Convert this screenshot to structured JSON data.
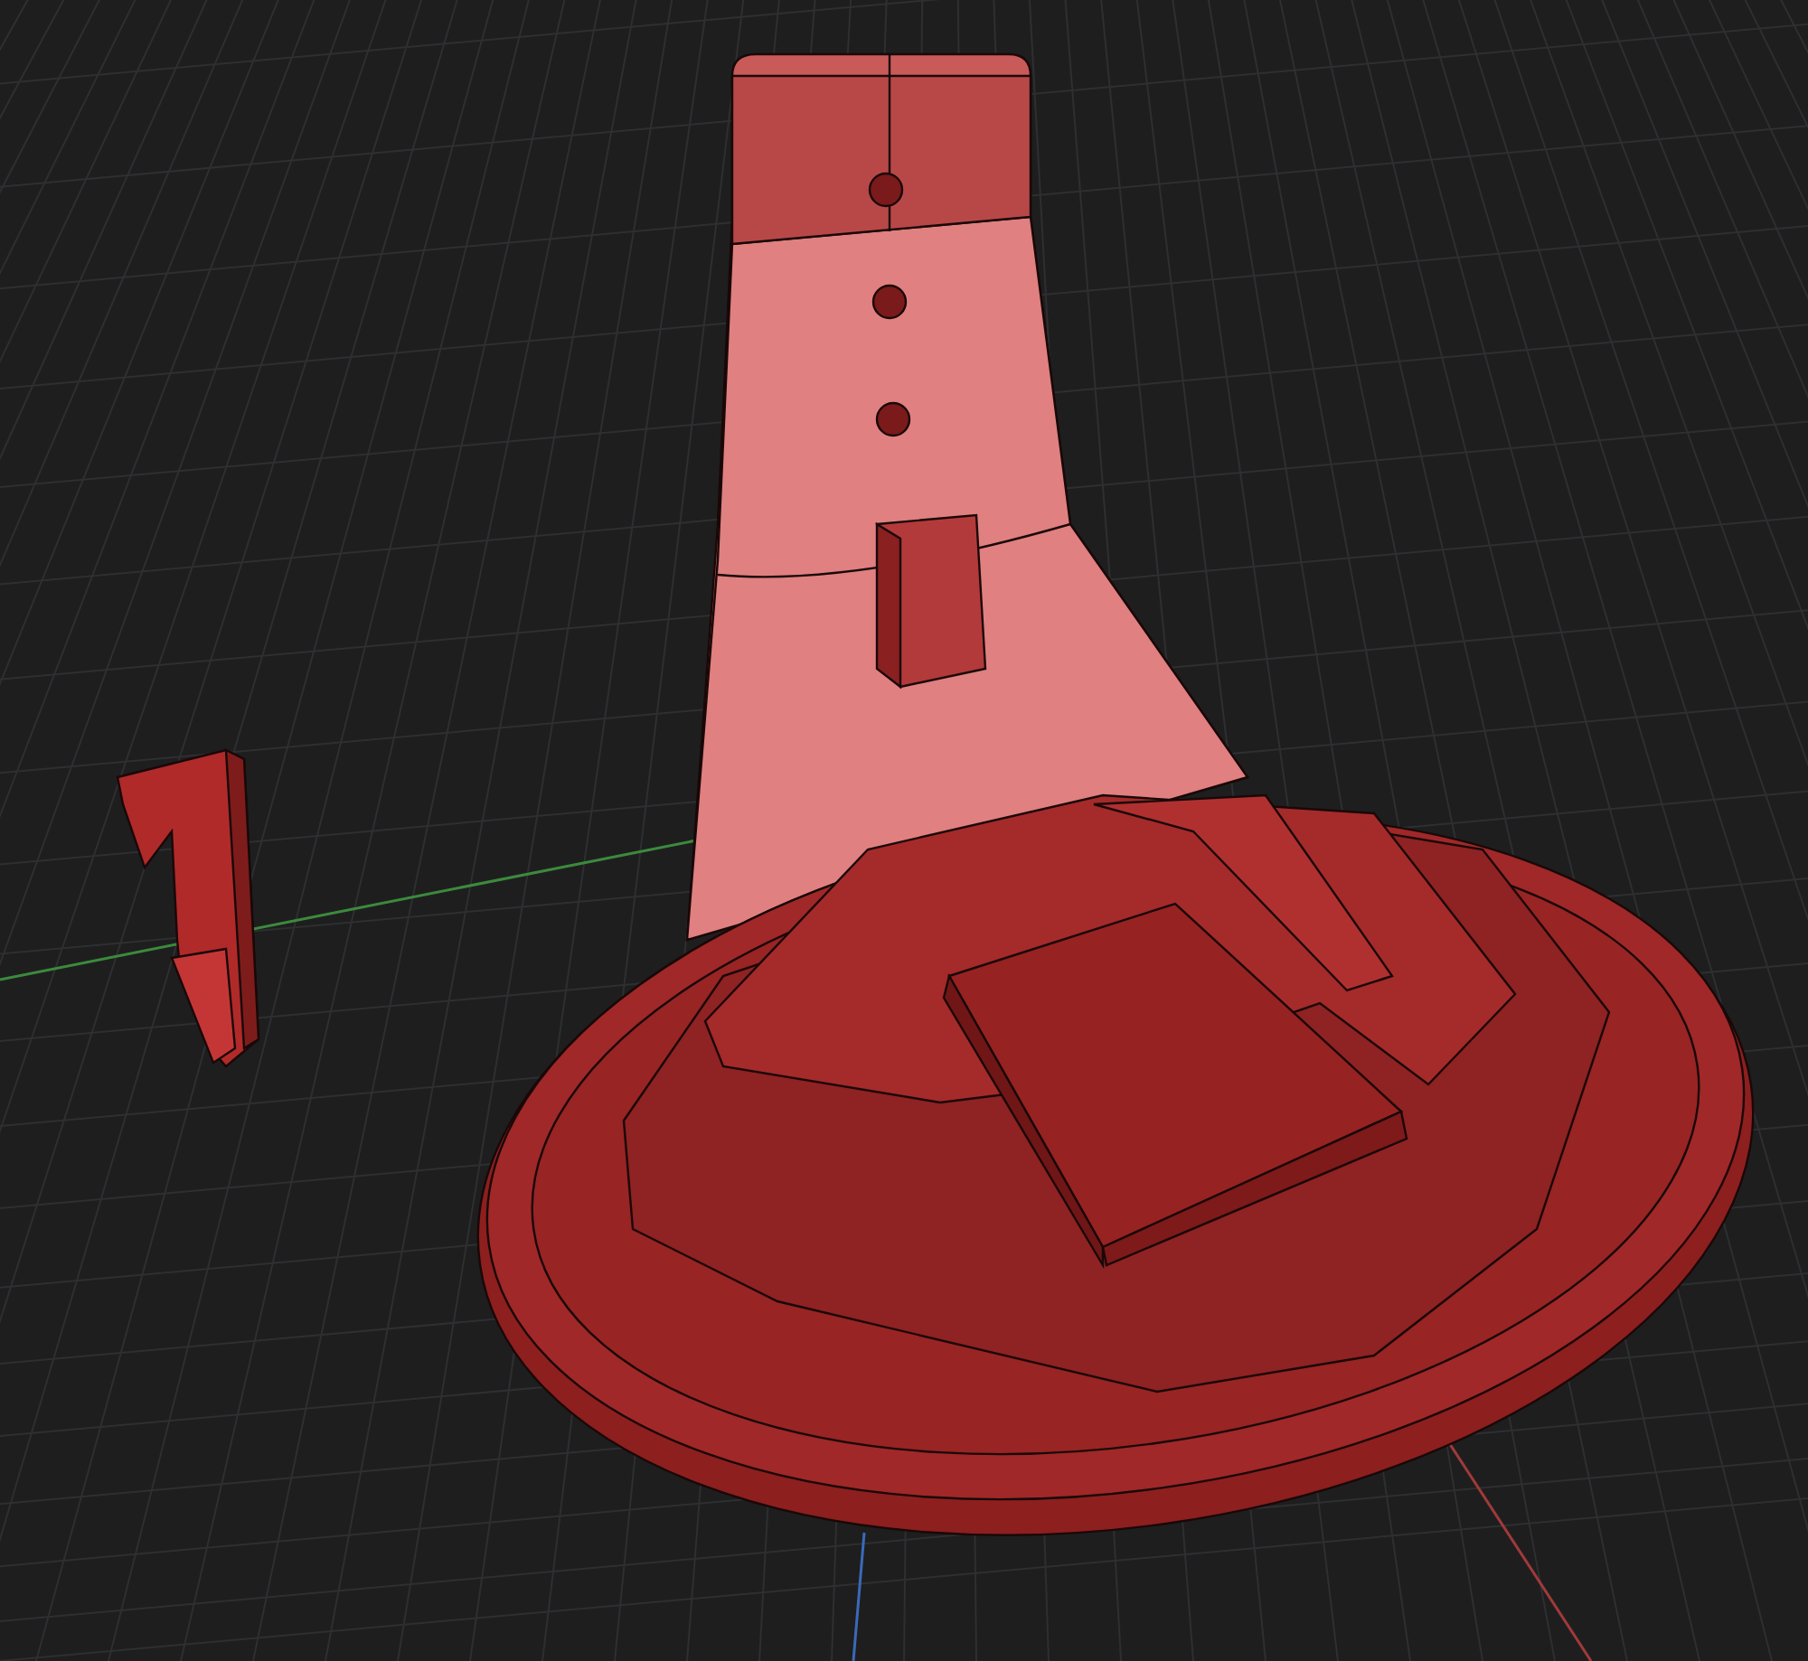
{
  "viewport": {
    "grid": true,
    "axes": true
  },
  "model": {
    "stand_visible": true,
    "clip_visible": true
  }
}
